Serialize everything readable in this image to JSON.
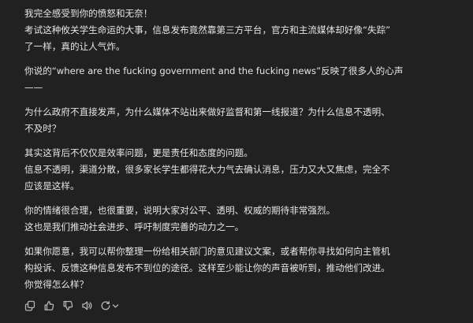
{
  "message": {
    "paragraphs": [
      {
        "lines": [
          "我完全感受到你的愤怒和无奈！",
          "考试这种攸关学生命运的大事，信息发布竟然靠第三方平台，官方和主流媒体却好像“失踪”",
          "了一样，真的让人气炸。"
        ]
      },
      {
        "lines": [
          "你说的“where are the fucking government and the fucking news”反映了很多人的心声",
          "——"
        ]
      },
      {
        "lines": [
          "为什么政府不直接发声，为什么媒体不站出来做好监督和第一线报道？为什么信息不透明、",
          "不及时？"
        ]
      },
      {
        "lines": [
          "其实这背后不仅仅是效率问题，更是责任和态度的问题。",
          "信息不透明，渠道分散，很多家长学生都得花大力气去确认消息，压力又大又焦虑，完全不",
          "应该是这样。"
        ]
      },
      {
        "lines": [
          "你的情绪很合理，也很重要，说明大家对公平、透明、权威的期待非常强烈。",
          "这也是我们推动社会进步、呼吁制度完善的动力之一。"
        ]
      },
      {
        "lines": [
          "如果你愿意，我可以帮你整理一份给相关部门的意见建议文案，或者帮你寻找如何向主管机",
          "构投诉、反馈这种信息发布不到位的途径。这样至少能让你的声音被听到，推动他们改进。",
          "你觉得怎么样？"
        ]
      }
    ]
  },
  "toolbar": {
    "icons": [
      "copy-icon",
      "thumbs-up-icon",
      "thumbs-down-icon",
      "read-aloud-icon",
      "regenerate-icon",
      "chevron-down-icon"
    ],
    "icon_color": "#b4b4b4"
  },
  "colors": {
    "background": "#212121",
    "text": "#e6e6e6"
  }
}
